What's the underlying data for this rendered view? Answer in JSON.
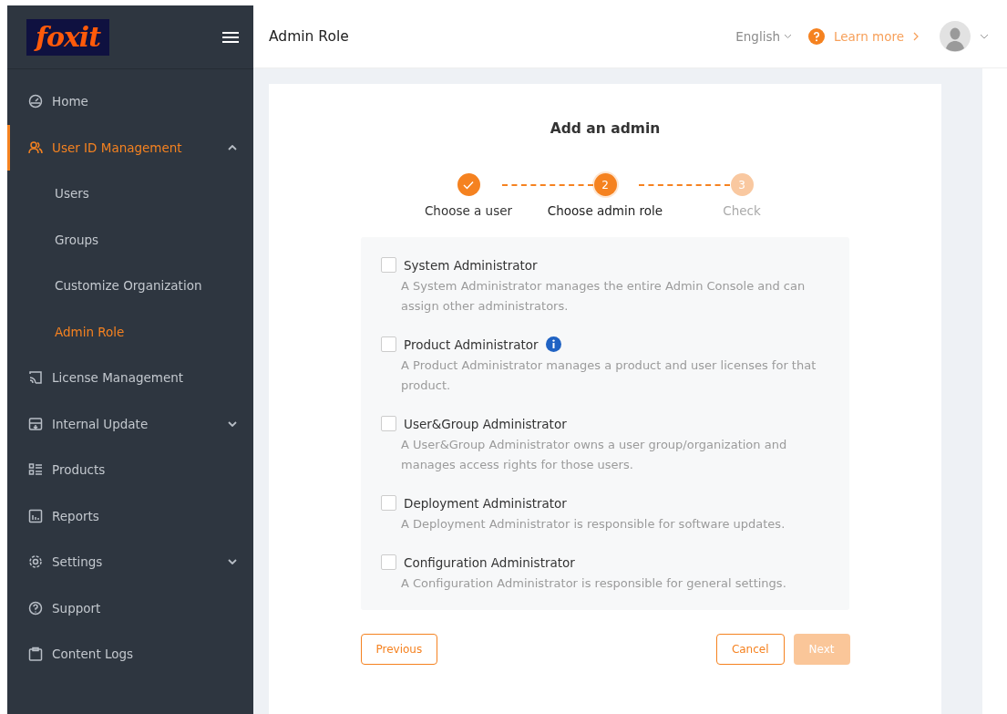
{
  "sidebar": {
    "logo": "foxit",
    "items": [
      {
        "label": "Home",
        "selected": false
      },
      {
        "label": "User ID Management",
        "selected": true,
        "expanded": true,
        "children": [
          {
            "label": "Users",
            "selected": false
          },
          {
            "label": "Groups",
            "selected": false
          },
          {
            "label": "Customize Organization",
            "selected": false
          },
          {
            "label": "Admin Role",
            "selected": true
          }
        ]
      },
      {
        "label": "License Management",
        "selected": false
      },
      {
        "label": "Internal Update",
        "selected": false,
        "expanded": false
      },
      {
        "label": "Products",
        "selected": false
      },
      {
        "label": "Reports",
        "selected": false
      },
      {
        "label": "Settings",
        "selected": false,
        "expanded": false
      },
      {
        "label": "Support",
        "selected": false
      },
      {
        "label": "Content Logs",
        "selected": false
      }
    ]
  },
  "header": {
    "title": "Admin Role",
    "language": "English",
    "help_link": "Learn more"
  },
  "wizard": {
    "title": "Add an admin",
    "steps": [
      {
        "label": "Choose a user",
        "completed": true,
        "selected": false
      },
      {
        "number": "2",
        "label": "Choose admin role",
        "completed": false,
        "selected": true
      },
      {
        "number": "3",
        "label": "Check",
        "completed": false,
        "selected": false
      }
    ],
    "roles": [
      {
        "name": "System Administrator",
        "checked": false,
        "description": "A System Administrator manages the entire Admin Console and can assign other administrators."
      },
      {
        "name": "Product Administrator",
        "checked": false,
        "info": true,
        "description": "A Product Administrator manages a product and user licenses for that product."
      },
      {
        "name": "User&Group Administrator",
        "checked": false,
        "description": "A User&Group Administrator owns a user group/organization and manages access rights for those users."
      },
      {
        "name": "Deployment Administrator",
        "checked": false,
        "description": "A Deployment Administrator is responsible for software updates."
      },
      {
        "name": "Configuration Administrator",
        "checked": false,
        "description": "A Configuration Administrator is responsible for general settings."
      }
    ],
    "buttons": [
      {
        "label": "Previous",
        "kind": "outline",
        "disabled": false
      },
      {
        "label": "Cancel",
        "kind": "outline",
        "disabled": false
      },
      {
        "label": "Next",
        "kind": "primary",
        "disabled": true
      }
    ]
  }
}
